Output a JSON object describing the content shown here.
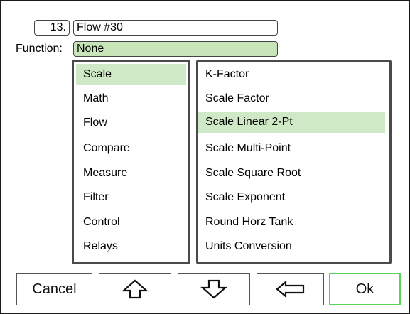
{
  "header": {
    "number": "13.",
    "name": "Flow #30",
    "function_label": "Function:",
    "function_value": "None"
  },
  "categories": [
    {
      "label": "Scale",
      "selected": true
    },
    {
      "label": "Math",
      "selected": false
    },
    {
      "label": "Flow",
      "selected": false
    },
    {
      "label": "Compare",
      "selected": false
    },
    {
      "label": "Measure",
      "selected": false
    },
    {
      "label": "Filter",
      "selected": false
    },
    {
      "label": "Control",
      "selected": false
    },
    {
      "label": "Relays",
      "selected": false
    }
  ],
  "functions": [
    {
      "label": "K-Factor",
      "selected": false
    },
    {
      "label": "Scale Factor",
      "selected": false
    },
    {
      "label": "Scale Linear 2-Pt",
      "selected": true
    },
    {
      "label": "Scale Multi-Point",
      "selected": false
    },
    {
      "label": "Scale Square Root",
      "selected": false
    },
    {
      "label": "Scale Exponent",
      "selected": false
    },
    {
      "label": "Round Horz Tank",
      "selected": false
    },
    {
      "label": "Units Conversion",
      "selected": false
    }
  ],
  "buttons": {
    "cancel": "Cancel",
    "up_icon": "arrow-up-icon",
    "down_icon": "arrow-down-icon",
    "back_icon": "arrow-left-icon",
    "ok": "Ok"
  },
  "colors": {
    "selection": "#cfe8c6",
    "function_field": "#c7e5b9",
    "ok_border": "#58d458"
  }
}
